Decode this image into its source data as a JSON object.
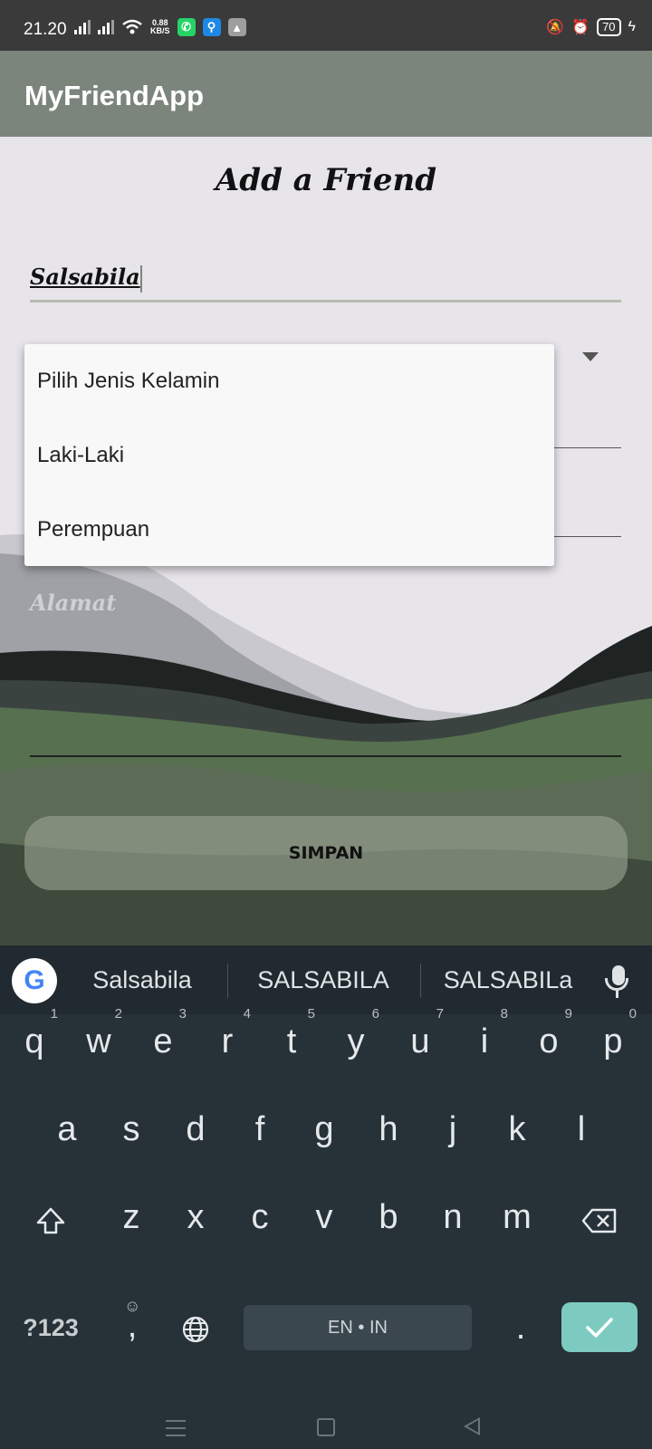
{
  "status_bar": {
    "time": "21.20",
    "net_speed_value": "0.88",
    "net_speed_unit": "KB/S",
    "battery": "70"
  },
  "app_bar": {
    "title": "MyFriendApp"
  },
  "form": {
    "title": "Add a Friend",
    "name_value": "Salsabila",
    "address_placeholder": "Alamat",
    "save_label": "SIMPAN"
  },
  "gender_dropdown": {
    "options": [
      "Pilih Jenis Kelamin",
      "Laki-Laki",
      "Perempuan"
    ]
  },
  "keyboard": {
    "suggestions": [
      "Salsabila",
      "SALSABILA",
      "SALSABILa"
    ],
    "row1": [
      "q",
      "w",
      "e",
      "r",
      "t",
      "y",
      "u",
      "i",
      "o",
      "p"
    ],
    "row1_hints": [
      "1",
      "2",
      "3",
      "4",
      "5",
      "6",
      "7",
      "8",
      "9",
      "0"
    ],
    "row2": [
      "a",
      "s",
      "d",
      "f",
      "g",
      "h",
      "j",
      "k",
      "l"
    ],
    "row3": [
      "z",
      "x",
      "c",
      "v",
      "b",
      "n",
      "m"
    ],
    "symbols_key": "?123",
    "comma_key": ",",
    "period_key": ".",
    "space_label": "EN • IN",
    "google_logo": "G"
  },
  "colors": {
    "app_bar": "#7c857b",
    "keyboard_bg": "#263238",
    "enter_key": "#7dcbc0"
  }
}
